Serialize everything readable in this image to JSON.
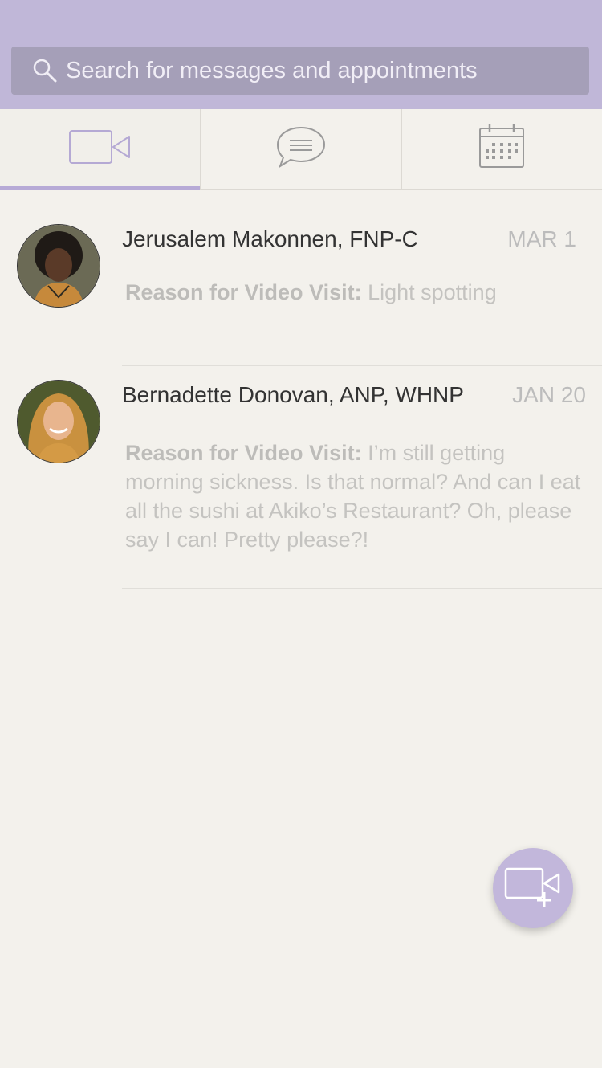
{
  "search": {
    "placeholder": "Search for messages and appointments"
  },
  "tabs": [
    {
      "icon": "video-camera-icon",
      "active": true
    },
    {
      "icon": "chat-bubble-icon",
      "active": false
    },
    {
      "icon": "calendar-icon",
      "active": false
    }
  ],
  "visits": [
    {
      "provider": "Jerusalem Makonnen, FNP-C",
      "date": "MAR 1",
      "reason_label": "Reason for Video Visit:",
      "reason_text": "Light spotting"
    },
    {
      "provider": "Bernadette Donovan, ANP, WHNP",
      "date": "JAN 20",
      "reason_label": "Reason for Video Visit:",
      "reason_text": "I’m still getting morning sickness. Is that normal? And can I eat all the sushi at Akiko’s Restaurant? Oh, please say I can! Pretty please?!"
    }
  ],
  "fab": {
    "icon": "new-video-visit-icon"
  },
  "colors": {
    "header": "#c0b7d8",
    "search_bg": "#a59fb8",
    "accent": "#b7aad6",
    "background": "#f3f1ec"
  }
}
